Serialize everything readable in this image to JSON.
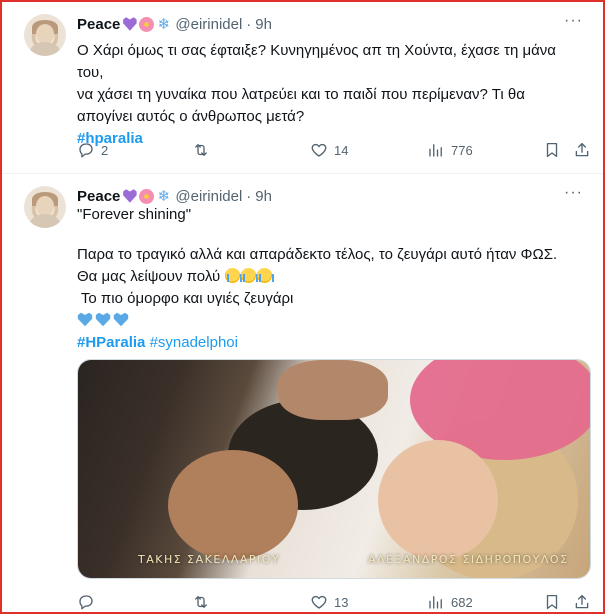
{
  "tweets": [
    {
      "author": {
        "name": "Peace",
        "handle": "@eirinidel",
        "dot": "·",
        "time": "9h"
      },
      "text_lines": [
        "Ο Χάρι όμως τι σας έφταιξε? Κυνηγημένος απ τη Χούντα, έχασε τη μάνα του,",
        "να χάσει τη γυναίκα που λατρεύει και το παιδί που περίμεναν? Τι θα",
        "απογίνει αυτός ο άνθρωπος μετά?"
      ],
      "hashtags": [
        "#hparalia"
      ],
      "stats": {
        "replies": "2",
        "retweets": "",
        "likes": "14",
        "views": "776"
      }
    },
    {
      "author": {
        "name": "Peace",
        "handle": "@eirinidel",
        "dot": "·",
        "time": "9h"
      },
      "text_lines": [
        "\"Forever shining\"",
        "Παρα το τραγικό αλλά και απαράδεκτο τέλος, το ζευγάρι αυτό ήταν ΦΩΣ.",
        "Θα μας λείψουν πολύ",
        " Το πιο όμορφο και υγιές ζευγάρι"
      ],
      "hashtags": [
        "#HParalia",
        "#synadelphoi"
      ],
      "media": {
        "caption_left": "ΤΑΚΗΣ ΣΑΚΕΛΛΑΡΙΟΥ",
        "caption_right": "ΑΛΕΞΑΝΔΡΟΣ ΣΙΔΗΡΟΠΟΥΛΟΣ"
      },
      "stats": {
        "replies": "",
        "retweets": "",
        "likes": "13",
        "views": "682"
      }
    }
  ],
  "icons": {
    "reply": "reply-icon",
    "retweet": "retweet-icon",
    "like": "heart-icon",
    "views": "views-icon",
    "bookmark": "bookmark-icon",
    "share": "share-icon",
    "more": "more-icon"
  },
  "more_glyph": "···",
  "colors": {
    "accent": "#1d9bf0",
    "muted": "#536471",
    "frame": "#e0302a"
  }
}
